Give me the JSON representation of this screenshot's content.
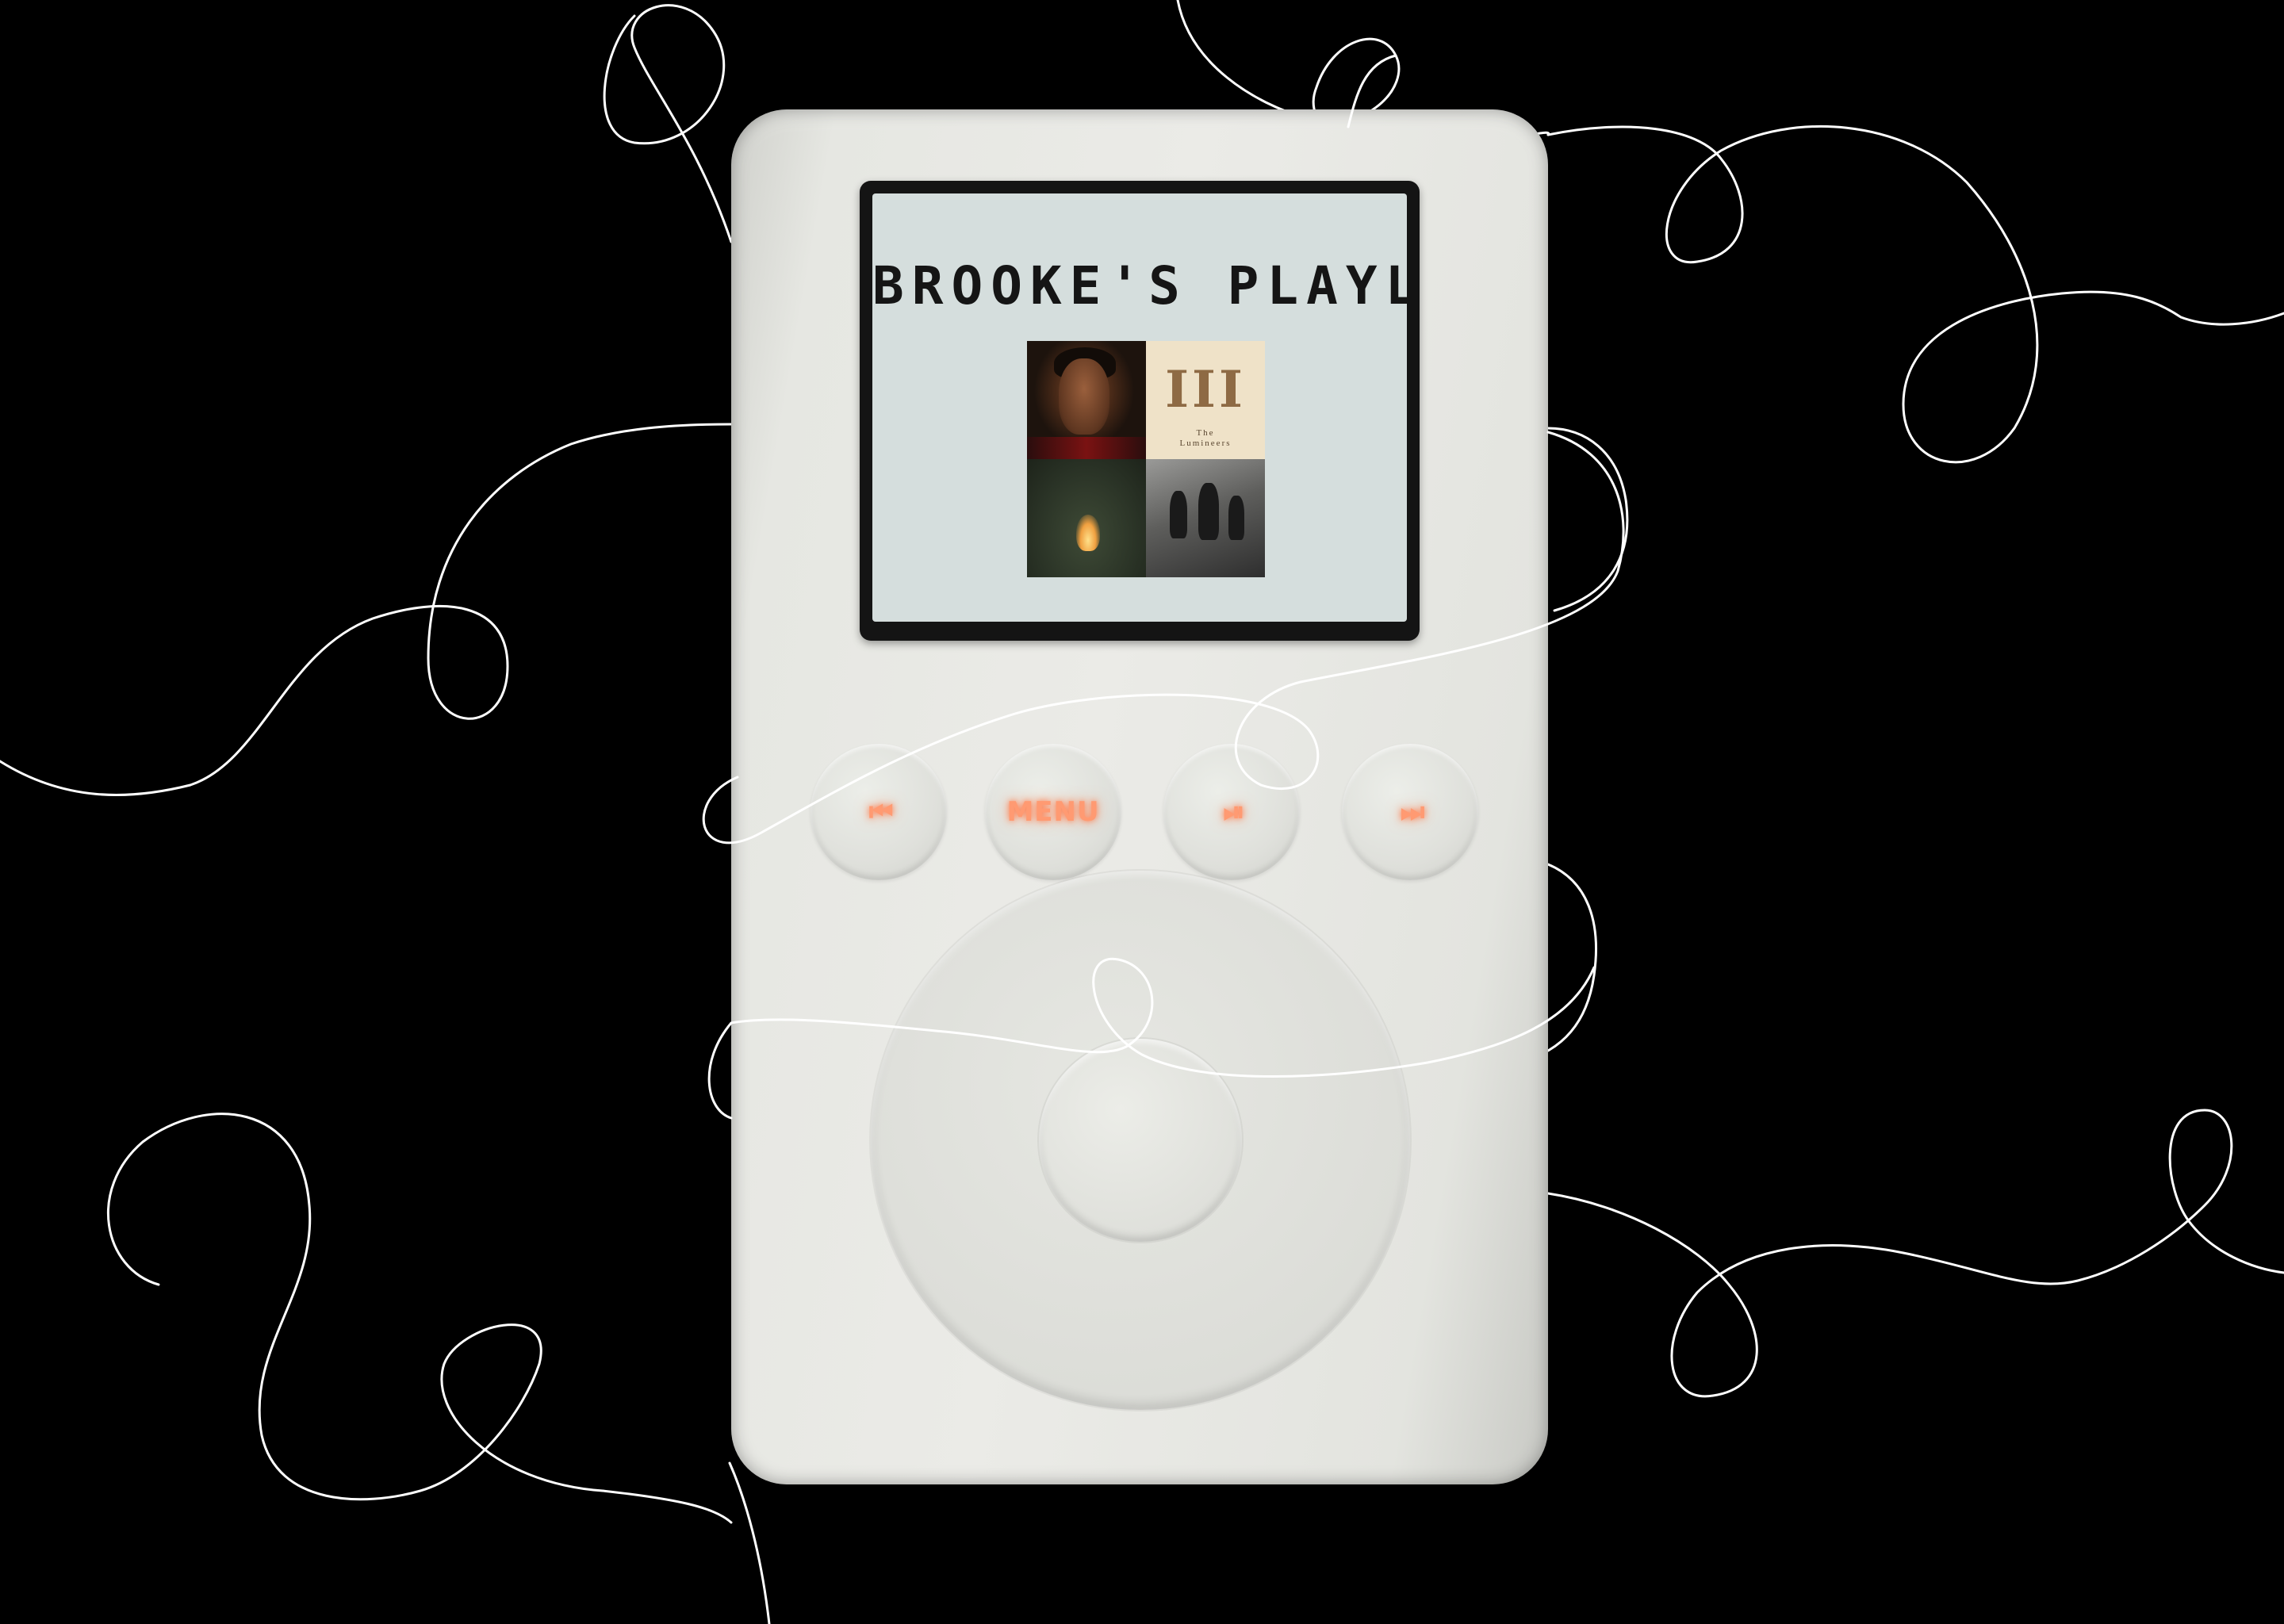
{
  "screen": {
    "title": "BROOKE'S PLAYLIST",
    "albums": [
      {
        "icon": "album-art-portrait"
      },
      {
        "icon": "album-art-lumineers",
        "numeral": "III",
        "artist": "The\nLumineers"
      },
      {
        "icon": "album-art-campfire"
      },
      {
        "icon": "album-art-silhouettes"
      }
    ]
  },
  "controls": {
    "prev_icon": "⏮",
    "menu_label": "MENU",
    "play_pause_icon": "⏯",
    "next_icon": "⏭"
  },
  "colors": {
    "background": "#000000",
    "body": "#e6e7e2",
    "screen": "#d5dedd",
    "button_glow": "#ff9a72",
    "cable": "#ffffff"
  }
}
